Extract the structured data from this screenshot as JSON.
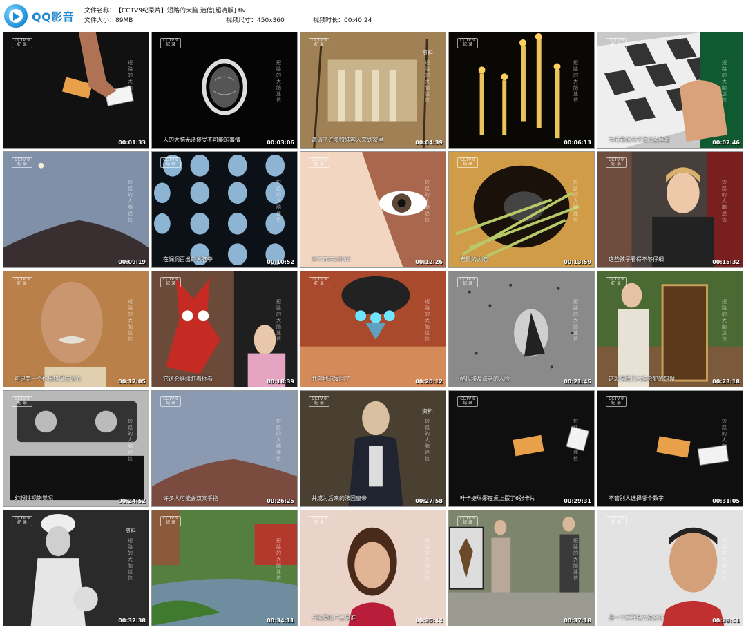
{
  "app": {
    "name": "QQ影音",
    "logo_icon": "qq-player-logo-icon"
  },
  "info": {
    "file_name_label": "文件名称：",
    "file_name": "【CCTV9纪录片】短路的大脑 迷信[超清版].flv",
    "file_size_label": "文件大小：",
    "file_size": "89MB",
    "video_dims_label": "视频尺寸：",
    "video_dims": "450x360",
    "duration_label": "视频时长：",
    "duration": "00:40:24"
  },
  "channel_logo": "CCTV 9 纪录",
  "side_title": "短路的大脑迷信",
  "frames": [
    {
      "ts": "00:01:33",
      "caption": "",
      "tag": "",
      "scene": "cards-hand"
    },
    {
      "ts": "00:03:06",
      "caption": "人的大脑无法接受不可能的事情",
      "tag": "",
      "scene": "brain-scan"
    },
    {
      "ts": "00:04:39",
      "caption": "邀请了许多特殊客人来到家里",
      "tag": "资料",
      "scene": "old-house"
    },
    {
      "ts": "00:06:13",
      "caption": "",
      "tag": "",
      "scene": "candles"
    },
    {
      "ts": "00:07:46",
      "caption": "为何看起来却迥然各异呢",
      "tag": "",
      "scene": "checkerboard"
    },
    {
      "ts": "00:09:19",
      "caption": "",
      "tag": "",
      "scene": "mountain-moon"
    },
    {
      "ts": "00:10:52",
      "caption": "在漏洞百出的大脑中",
      "tag": "",
      "scene": "brain-grid"
    },
    {
      "ts": "00:12:26",
      "caption": "本不存在的物体",
      "tag": "",
      "scene": "eye"
    },
    {
      "ts": "00:13:59",
      "caption": "老鼠的大脑",
      "tag": "",
      "scene": "mouse-hole"
    },
    {
      "ts": "00:15:32",
      "caption": "这些孩子看得不够仔细",
      "tag": "",
      "scene": "boy"
    },
    {
      "ts": "00:17:05",
      "caption": "可是第一个作出错误结论的",
      "tag": "",
      "scene": "old-man"
    },
    {
      "ts": "00:18:39",
      "caption": "它还会继续盯着你看",
      "tag": "",
      "scene": "dragon"
    },
    {
      "ts": "00:20:12",
      "caption": "并向地球发回了",
      "tag": "",
      "scene": "probe"
    },
    {
      "ts": "00:21:45",
      "caption": "酷似埃及法老的人脸",
      "tag": "",
      "scene": "mars-face"
    },
    {
      "ts": "00:23:18",
      "caption": "这就是我们大脑会犯的错误",
      "tag": "",
      "scene": "park-painting"
    },
    {
      "ts": "00:24:52",
      "caption": "幻想性视错觉呢",
      "tag": "",
      "scene": "car-panel"
    },
    {
      "ts": "00:26:25",
      "caption": "许多人可能会双叉手指",
      "tag": "",
      "scene": "mountain-dusk"
    },
    {
      "ts": "00:27:58",
      "caption": "并成为后来的法国皇帝",
      "tag": "资料",
      "scene": "napoleon"
    },
    {
      "ts": "00:29:31",
      "caption": "叶卡捷琳娜在桌上摆了6张卡片",
      "tag": "",
      "scene": "card-table"
    },
    {
      "ts": "00:31:05",
      "caption": "不管别人选择哪个数字",
      "tag": "",
      "scene": "card-table-2"
    },
    {
      "ts": "00:32:38",
      "caption": "",
      "tag": "资料",
      "scene": "mystic"
    },
    {
      "ts": "00:34:11",
      "caption": "",
      "tag": "",
      "scene": "river-mill"
    },
    {
      "ts": "00:35:44",
      "caption": "只能猜出户主是谁",
      "tag": "",
      "scene": "woman"
    },
    {
      "ts": "00:37:18",
      "caption": "",
      "tag": "",
      "scene": "park-people"
    },
    {
      "ts": "00:38:51",
      "caption": "另一个解释是大脑会错",
      "tag": "",
      "scene": "man-talking"
    }
  ]
}
